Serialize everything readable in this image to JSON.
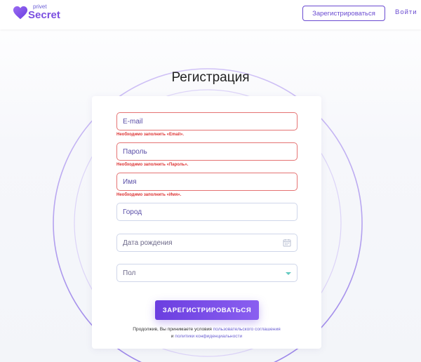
{
  "header": {
    "logo_small": "privet",
    "logo_big": "Secret",
    "register_label": "Зарегистрироваться",
    "login_label": "Войти"
  },
  "page": {
    "title": "Регистрация"
  },
  "form": {
    "email": {
      "placeholder": "E-mail",
      "error": "Необходимо заполнить «Email»."
    },
    "password": {
      "placeholder": "Пароль",
      "error": "Необходимо заполнить «Пароль»."
    },
    "name": {
      "placeholder": "Имя",
      "error": "Необходимо заполнить «Имя»."
    },
    "city": {
      "placeholder": "Город"
    },
    "birthdate": {
      "placeholder": "Дата рождения"
    },
    "gender": {
      "placeholder": "Пол"
    },
    "submit_label": "ЗАРЕГИСТРИРОВАТЬСЯ",
    "terms_prefix": "Продолжив, Вы принимаете условия",
    "terms_link1": "пользовательского соглашения",
    "terms_and": "и",
    "terms_link2": "политики конфиденциальности"
  },
  "icons": {
    "logo": "heart-logo-icon",
    "calendar": "calendar-icon",
    "dropdown": "chevron-down-icon"
  },
  "colors": {
    "accent": "#6a4bd1",
    "error": "#e57373",
    "error_text": "#dd3333",
    "button_gradient_start": "#6b3ee0",
    "button_gradient_end": "#8a5ff0"
  }
}
